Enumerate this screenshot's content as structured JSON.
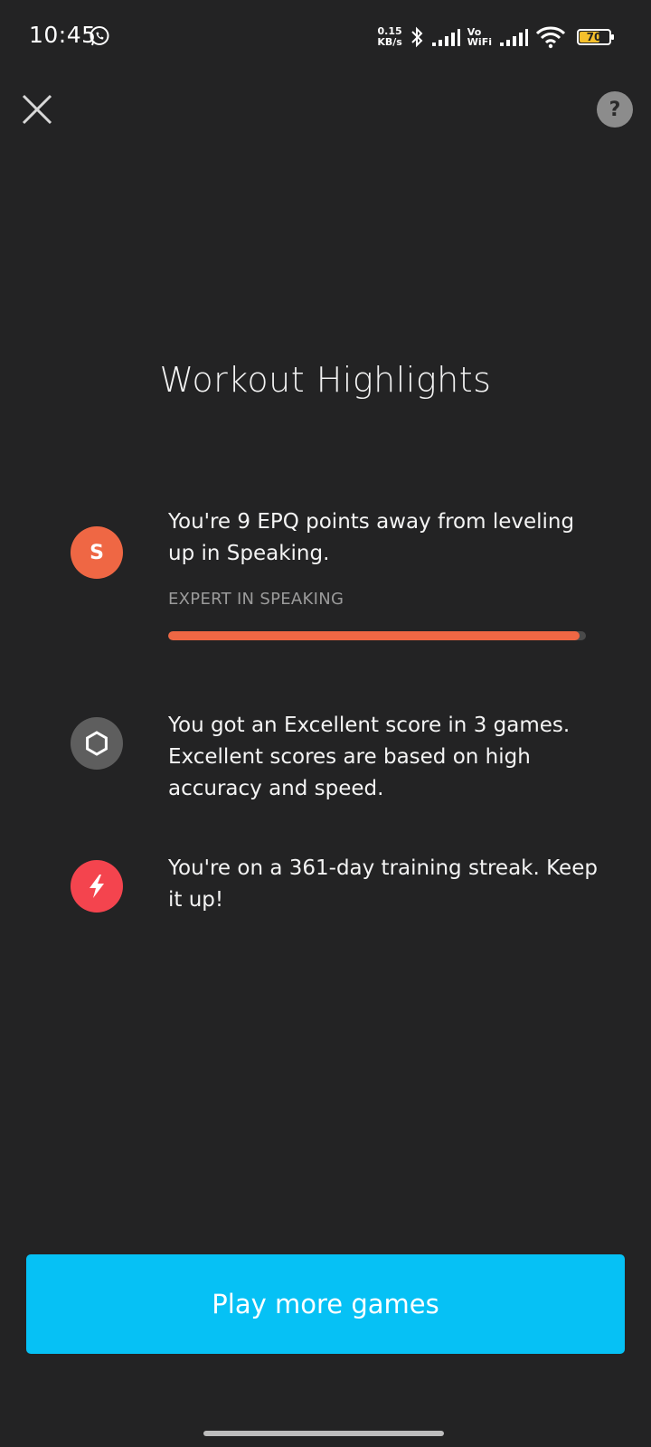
{
  "status_bar": {
    "time": "10:45",
    "net_speed_value": "0.15",
    "net_speed_unit": "KB/s",
    "volte_top": "Vo",
    "volte_bottom": "WiFi",
    "battery_level": "70",
    "battery_fraction": 0.7
  },
  "header": {
    "close_icon": "close-icon",
    "help_label": "?"
  },
  "title": "Workout Highlights",
  "highlights": [
    {
      "icon_letter": "S",
      "icon_color": "#ef6744",
      "text": "You're 9 EPQ points away from leveling up in Speaking.",
      "progress_label": "EXPERT IN SPEAKING",
      "progress_fraction": 0.985
    },
    {
      "icon": "hexagon-icon",
      "icon_color": "#5e5e5e",
      "text": "You got an Excellent score in 3 games. Excellent scores are based on high accuracy and speed."
    },
    {
      "icon": "lightning-icon",
      "icon_color": "#f4444e",
      "text": "You're on a 361-day training streak. Keep it up!"
    }
  ],
  "cta": {
    "label": "Play more games",
    "color": "#06c1f5"
  }
}
